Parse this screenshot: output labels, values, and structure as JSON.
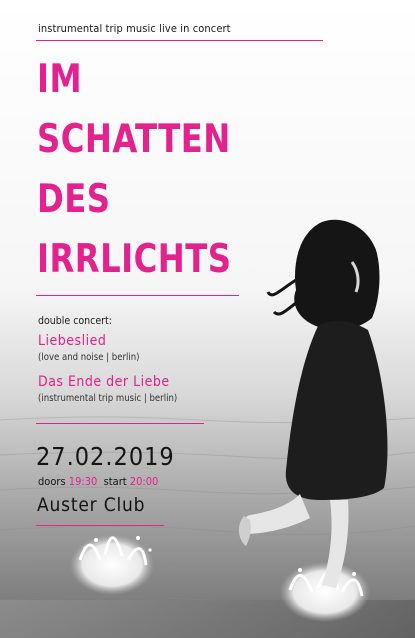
{
  "tagline": "instrumental trip music live in concert",
  "title": [
    "IM",
    "SCHATTEN",
    "DES",
    "IRRLICHTS"
  ],
  "double_concert_label": "double concert:",
  "bands": [
    {
      "name": "Liebeslied",
      "info": "(love and noise | berlin)"
    },
    {
      "name": "Das Ende der Liebe",
      "info": "(instrumental trip music | berlin)"
    }
  ],
  "date": "27.02.2019",
  "doors_label": "doors",
  "doors_time": "19:30",
  "start_label": "start",
  "start_time": "20:00",
  "venue": "Auster Club",
  "colors": {
    "accent": "#e4218c",
    "text": "#1a1a1a"
  }
}
